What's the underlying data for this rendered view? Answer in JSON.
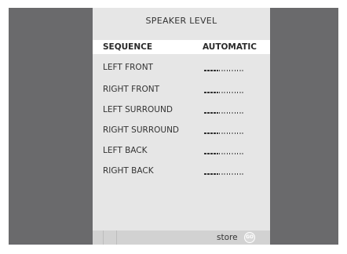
{
  "menu": {
    "title": "SPEAKER LEVEL",
    "rows": [
      {
        "label": "SEQUENCE",
        "value": "AUTOMATIC"
      },
      {
        "label": "LEFT FRONT",
        "level": 0.35
      },
      {
        "label": "RIGHT FRONT",
        "level": 0.35
      },
      {
        "label": "LEFT SURROUND",
        "level": 0.35
      },
      {
        "label": "RIGHT SURROUND",
        "level": 0.35
      },
      {
        "label": "LEFT BACK",
        "level": 0.35
      },
      {
        "label": "RIGHT BACK",
        "level": 0.35
      }
    ]
  },
  "status_bar": {
    "store_label": "store",
    "go_icon": "GO"
  },
  "colors": {
    "background": "#6a6a6c",
    "menu_panel": "#e6e6e6",
    "selected_row": "#ffffff",
    "status_bar": "#d2d2d2"
  }
}
